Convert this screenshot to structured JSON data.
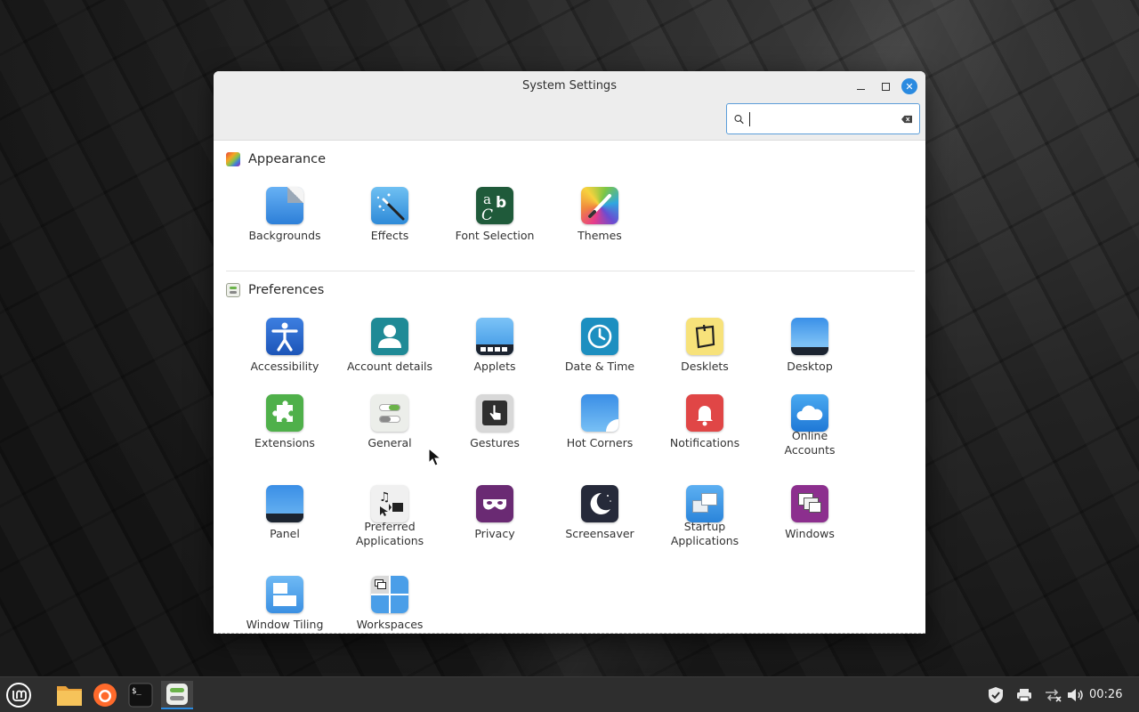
{
  "window": {
    "title": "System Settings",
    "search": {
      "value": "",
      "placeholder": ""
    }
  },
  "sections": {
    "appearance": {
      "title": "Appearance",
      "items": [
        {
          "label": "Backgrounds",
          "icon": "backgrounds-icon"
        },
        {
          "label": "Effects",
          "icon": "effects-icon"
        },
        {
          "label": "Font Selection",
          "icon": "font-selection-icon"
        },
        {
          "label": "Themes",
          "icon": "themes-icon"
        }
      ]
    },
    "preferences": {
      "title": "Preferences",
      "items": [
        {
          "label": "Accessibility",
          "icon": "accessibility-icon"
        },
        {
          "label": "Account details",
          "icon": "account-details-icon"
        },
        {
          "label": "Applets",
          "icon": "applets-icon"
        },
        {
          "label": "Date & Time",
          "icon": "date-time-icon"
        },
        {
          "label": "Desklets",
          "icon": "desklets-icon"
        },
        {
          "label": "Desktop",
          "icon": "desktop-icon"
        },
        {
          "label": "Extensions",
          "icon": "extensions-icon"
        },
        {
          "label": "General",
          "icon": "general-icon"
        },
        {
          "label": "Gestures",
          "icon": "gestures-icon"
        },
        {
          "label": "Hot Corners",
          "icon": "hot-corners-icon"
        },
        {
          "label": "Notifications",
          "icon": "notifications-icon"
        },
        {
          "label": "Online Accounts",
          "line1": "Online",
          "line2": "Accounts",
          "icon": "online-accounts-icon"
        },
        {
          "label": "Panel",
          "icon": "panel-icon"
        },
        {
          "label": "Preferred Applications",
          "line1": "Preferred",
          "line2": "Applications",
          "icon": "preferred-applications-icon"
        },
        {
          "label": "Privacy",
          "icon": "privacy-icon"
        },
        {
          "label": "Screensaver",
          "icon": "screensaver-icon"
        },
        {
          "label": "Startup Applications",
          "line1": "Startup",
          "line2": "Applications",
          "icon": "startup-applications-icon"
        },
        {
          "label": "Windows",
          "icon": "windows-icon"
        },
        {
          "label": "Window Tiling",
          "icon": "window-tiling-icon"
        },
        {
          "label": "Workspaces",
          "icon": "workspaces-icon"
        }
      ]
    }
  },
  "taskbar": {
    "launchers": [
      "mint-menu-icon",
      "files-icon",
      "firefox-icon",
      "terminal-icon",
      "system-settings-icon"
    ],
    "tray": [
      "shield-icon",
      "printer-icon",
      "network-icon",
      "volume-icon"
    ],
    "clock": "00:26"
  },
  "colors": {
    "accent": "#2a8ae0",
    "taskbar": "#2e2e2e"
  }
}
